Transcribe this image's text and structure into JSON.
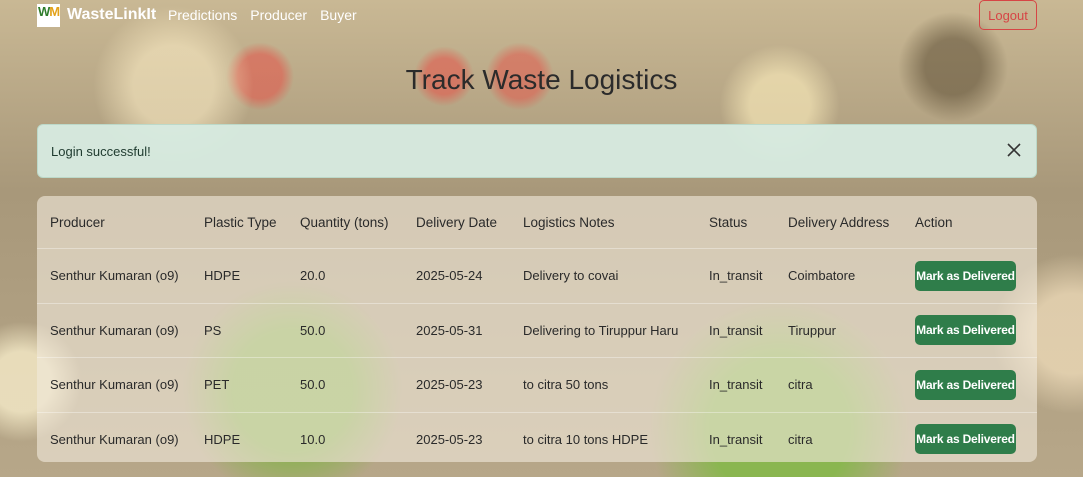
{
  "nav": {
    "brand": "WasteLinkIt",
    "links": [
      "Predictions",
      "Producer",
      "Buyer"
    ],
    "logout": "Logout"
  },
  "page": {
    "title": "Track Waste Logistics"
  },
  "alert": {
    "message": "Login successful!"
  },
  "table": {
    "headers": [
      "Producer",
      "Plastic Type",
      "Quantity (tons)",
      "Delivery Date",
      "Logistics Notes",
      "Status",
      "Delivery Address",
      "Action"
    ],
    "rows": [
      {
        "producer": "Senthur Kumaran (o9)",
        "plastic_type": "HDPE",
        "quantity": "20.0",
        "delivery_date": "2025-05-24",
        "notes": "Delivery to covai",
        "status": "In_transit",
        "address": "Coimbatore",
        "action": "Mark as Delivered"
      },
      {
        "producer": "Senthur Kumaran (o9)",
        "plastic_type": "PS",
        "quantity": "50.0",
        "delivery_date": "2025-05-31",
        "notes": "Delivering to Tiruppur Haru",
        "status": "In_transit",
        "address": "Tiruppur",
        "action": "Mark as Delivered"
      },
      {
        "producer": "Senthur Kumaran (o9)",
        "plastic_type": "PET",
        "quantity": "50.0",
        "delivery_date": "2025-05-23",
        "notes": "to citra 50 tons",
        "status": "In_transit",
        "address": "citra",
        "action": "Mark as Delivered"
      },
      {
        "producer": "Senthur Kumaran (o9)",
        "plastic_type": "HDPE",
        "quantity": "10.0",
        "delivery_date": "2025-05-23",
        "notes": "to citra 10 tons HDPE",
        "status": "In_transit",
        "address": "citra",
        "action": "Mark as Delivered"
      }
    ]
  },
  "colors": {
    "accent_green": "#2f7d4a",
    "logout_red": "#d64545",
    "alert_bg": "#d6eae0"
  }
}
